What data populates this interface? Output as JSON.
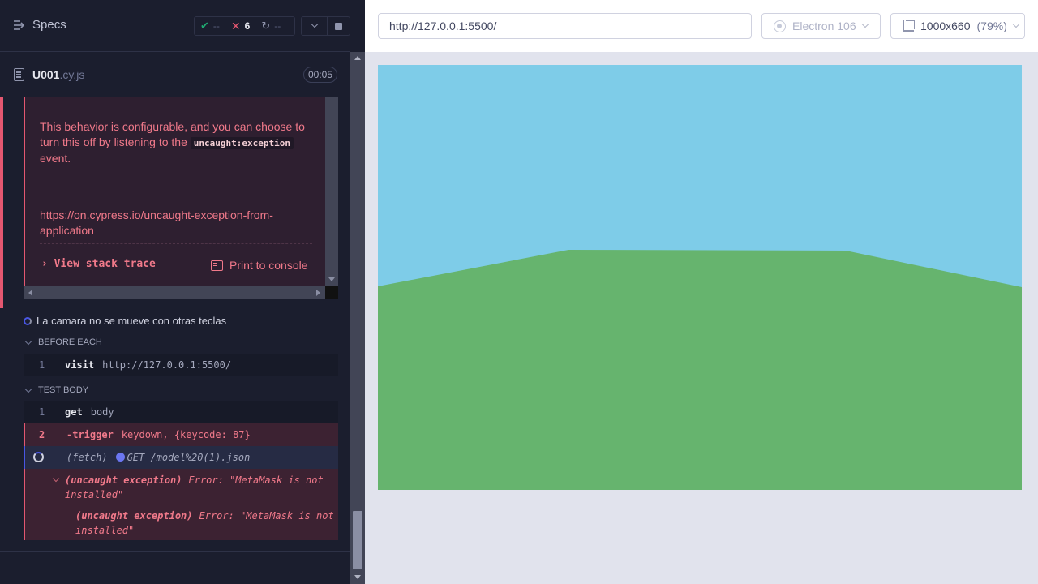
{
  "reporter": {
    "specs_label": "Specs",
    "stats": {
      "passed": "--",
      "failed": "6",
      "pending": "--"
    },
    "spec": {
      "name": "U001",
      "ext": ".cy.js",
      "duration": "00:05"
    },
    "error": {
      "text_before": "This behavior is configurable, and you can choose to turn this off by listening to the",
      "code": "uncaught:exception",
      "text_after": "event.",
      "link": "https://on.cypress.io/uncaught-exception-from-application",
      "view_stack_label": "View stack trace",
      "print_label": "Print to console"
    },
    "test_title": "La camara no se mueve con otras teclas",
    "before_each": {
      "label": "BEFORE EACH",
      "commands": [
        {
          "num": "1",
          "name": "visit",
          "message": "http://127.0.0.1:5500/"
        }
      ]
    },
    "test_body": {
      "label": "TEST BODY",
      "commands": [
        {
          "num": "1",
          "name": "get",
          "message": "body"
        },
        {
          "num": "2",
          "name": "-trigger",
          "message": "keydown, {keycode: 87}"
        },
        {
          "num": "",
          "name": "(fetch)",
          "message": "GET /model%20(1).json"
        }
      ],
      "exceptions": [
        {
          "type": "(uncaught exception)",
          "message": "Error: \"MetaMask is not installed\""
        },
        {
          "type": "(uncaught exception)",
          "message": "Error: \"MetaMask is not installed\""
        }
      ]
    }
  },
  "aut": {
    "url": "http://127.0.0.1:5500/",
    "browser": "Electron 106",
    "viewport": "1000x660",
    "scale": "(79%)",
    "scene": {
      "sky_color": "#7ecce8",
      "ground_color": "#66b46e"
    }
  },
  "icons": {
    "specs": "menu-arrow-icon",
    "passed": "check-icon",
    "failed": "x-icon",
    "pending": "spinner-icon",
    "stop": "stop-icon"
  },
  "colors": {
    "error": "#e45770",
    "accent": "#4956e3",
    "pass": "#1fa971"
  }
}
